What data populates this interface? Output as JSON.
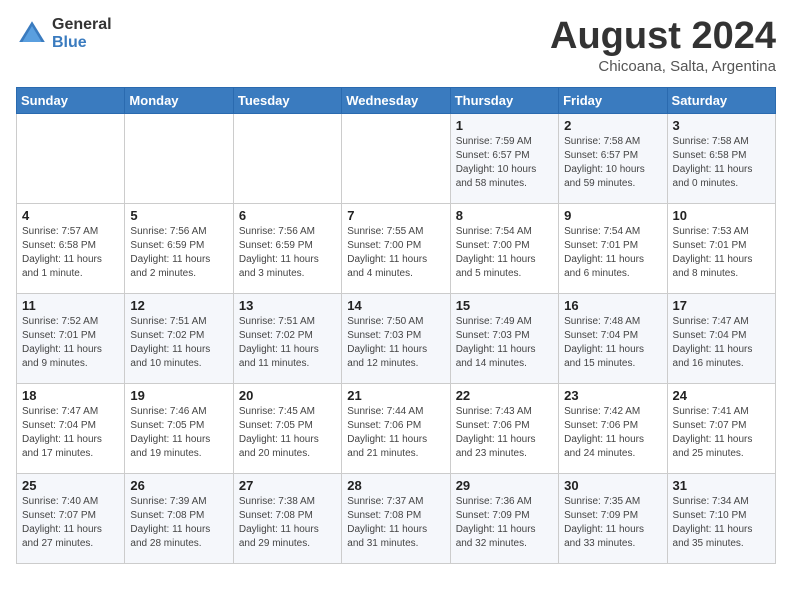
{
  "header": {
    "logo_general": "General",
    "logo_blue": "Blue",
    "month_title": "August 2024",
    "location": "Chicoana, Salta, Argentina"
  },
  "days_of_week": [
    "Sunday",
    "Monday",
    "Tuesday",
    "Wednesday",
    "Thursday",
    "Friday",
    "Saturday"
  ],
  "weeks": [
    [
      {
        "day": "",
        "info": ""
      },
      {
        "day": "",
        "info": ""
      },
      {
        "day": "",
        "info": ""
      },
      {
        "day": "",
        "info": ""
      },
      {
        "day": "1",
        "info": "Sunrise: 7:59 AM\nSunset: 6:57 PM\nDaylight: 10 hours\nand 58 minutes."
      },
      {
        "day": "2",
        "info": "Sunrise: 7:58 AM\nSunset: 6:57 PM\nDaylight: 10 hours\nand 59 minutes."
      },
      {
        "day": "3",
        "info": "Sunrise: 7:58 AM\nSunset: 6:58 PM\nDaylight: 11 hours\nand 0 minutes."
      }
    ],
    [
      {
        "day": "4",
        "info": "Sunrise: 7:57 AM\nSunset: 6:58 PM\nDaylight: 11 hours\nand 1 minute."
      },
      {
        "day": "5",
        "info": "Sunrise: 7:56 AM\nSunset: 6:59 PM\nDaylight: 11 hours\nand 2 minutes."
      },
      {
        "day": "6",
        "info": "Sunrise: 7:56 AM\nSunset: 6:59 PM\nDaylight: 11 hours\nand 3 minutes."
      },
      {
        "day": "7",
        "info": "Sunrise: 7:55 AM\nSunset: 7:00 PM\nDaylight: 11 hours\nand 4 minutes."
      },
      {
        "day": "8",
        "info": "Sunrise: 7:54 AM\nSunset: 7:00 PM\nDaylight: 11 hours\nand 5 minutes."
      },
      {
        "day": "9",
        "info": "Sunrise: 7:54 AM\nSunset: 7:01 PM\nDaylight: 11 hours\nand 6 minutes."
      },
      {
        "day": "10",
        "info": "Sunrise: 7:53 AM\nSunset: 7:01 PM\nDaylight: 11 hours\nand 8 minutes."
      }
    ],
    [
      {
        "day": "11",
        "info": "Sunrise: 7:52 AM\nSunset: 7:01 PM\nDaylight: 11 hours\nand 9 minutes."
      },
      {
        "day": "12",
        "info": "Sunrise: 7:51 AM\nSunset: 7:02 PM\nDaylight: 11 hours\nand 10 minutes."
      },
      {
        "day": "13",
        "info": "Sunrise: 7:51 AM\nSunset: 7:02 PM\nDaylight: 11 hours\nand 11 minutes."
      },
      {
        "day": "14",
        "info": "Sunrise: 7:50 AM\nSunset: 7:03 PM\nDaylight: 11 hours\nand 12 minutes."
      },
      {
        "day": "15",
        "info": "Sunrise: 7:49 AM\nSunset: 7:03 PM\nDaylight: 11 hours\nand 14 minutes."
      },
      {
        "day": "16",
        "info": "Sunrise: 7:48 AM\nSunset: 7:04 PM\nDaylight: 11 hours\nand 15 minutes."
      },
      {
        "day": "17",
        "info": "Sunrise: 7:47 AM\nSunset: 7:04 PM\nDaylight: 11 hours\nand 16 minutes."
      }
    ],
    [
      {
        "day": "18",
        "info": "Sunrise: 7:47 AM\nSunset: 7:04 PM\nDaylight: 11 hours\nand 17 minutes."
      },
      {
        "day": "19",
        "info": "Sunrise: 7:46 AM\nSunset: 7:05 PM\nDaylight: 11 hours\nand 19 minutes."
      },
      {
        "day": "20",
        "info": "Sunrise: 7:45 AM\nSunset: 7:05 PM\nDaylight: 11 hours\nand 20 minutes."
      },
      {
        "day": "21",
        "info": "Sunrise: 7:44 AM\nSunset: 7:06 PM\nDaylight: 11 hours\nand 21 minutes."
      },
      {
        "day": "22",
        "info": "Sunrise: 7:43 AM\nSunset: 7:06 PM\nDaylight: 11 hours\nand 23 minutes."
      },
      {
        "day": "23",
        "info": "Sunrise: 7:42 AM\nSunset: 7:06 PM\nDaylight: 11 hours\nand 24 minutes."
      },
      {
        "day": "24",
        "info": "Sunrise: 7:41 AM\nSunset: 7:07 PM\nDaylight: 11 hours\nand 25 minutes."
      }
    ],
    [
      {
        "day": "25",
        "info": "Sunrise: 7:40 AM\nSunset: 7:07 PM\nDaylight: 11 hours\nand 27 minutes."
      },
      {
        "day": "26",
        "info": "Sunrise: 7:39 AM\nSunset: 7:08 PM\nDaylight: 11 hours\nand 28 minutes."
      },
      {
        "day": "27",
        "info": "Sunrise: 7:38 AM\nSunset: 7:08 PM\nDaylight: 11 hours\nand 29 minutes."
      },
      {
        "day": "28",
        "info": "Sunrise: 7:37 AM\nSunset: 7:08 PM\nDaylight: 11 hours\nand 31 minutes."
      },
      {
        "day": "29",
        "info": "Sunrise: 7:36 AM\nSunset: 7:09 PM\nDaylight: 11 hours\nand 32 minutes."
      },
      {
        "day": "30",
        "info": "Sunrise: 7:35 AM\nSunset: 7:09 PM\nDaylight: 11 hours\nand 33 minutes."
      },
      {
        "day": "31",
        "info": "Sunrise: 7:34 AM\nSunset: 7:10 PM\nDaylight: 11 hours\nand 35 minutes."
      }
    ]
  ]
}
